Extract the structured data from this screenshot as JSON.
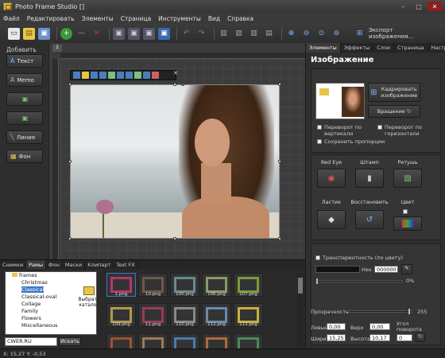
{
  "window": {
    "title": "Photo Frame Studio []"
  },
  "menu": [
    "Файл",
    "Редактировать",
    "Элементы",
    "Страница",
    "Инструменты",
    "Вид",
    "Справка"
  ],
  "toolbar": {
    "export_label": "Экспорт изображения..."
  },
  "left_panel": {
    "add_label": "Добавить",
    "buttons": [
      "Текст",
      "Memo",
      "",
      "",
      "Линия",
      "Фон"
    ]
  },
  "canvas": {
    "tab": "1"
  },
  "right_panel": {
    "tabs": [
      "Элементы",
      "Эффекты",
      "Слои",
      "Страница",
      "Настр"
    ],
    "title": "Изображение",
    "crop_label": "Кадрировать изображение",
    "rotate_label": "Вращение",
    "flip_v": "Переворот по вертикали",
    "flip_h": "Переворот по горизонтали",
    "keep_ratio": "Сохранить пропорции",
    "tools": [
      "Red Eye",
      "Штамп",
      "Ретушь",
      "Ластик",
      "Восстановить",
      "Цвет"
    ],
    "transparency_label": "Транспарентность (по цвету)",
    "hex_label": "Hex",
    "hex_value": "000000",
    "percent_label": "0%",
    "opacity_label": "Прозрачность",
    "opacity_value": "255",
    "left_label": "Левый",
    "left_value": "0,00",
    "top_label": "Верх",
    "top_value": "0,00",
    "angle_label": "Угол поворота",
    "angle_value": "0",
    "width_label": "Ширина",
    "width_value": "15,25",
    "height_label": "Высота",
    "height_value": "10,17"
  },
  "bottom_panel": {
    "tabs": [
      "Снимки",
      "Рамы",
      "Фон",
      "Маски",
      "Клипарт",
      "Text FX"
    ],
    "active_tab": "Рамы",
    "tree_root": "frames",
    "tree_items": [
      "Christmas",
      "Classical",
      "Classical-oval",
      "Collage",
      "Family",
      "Flowers",
      "Miscellaneous"
    ],
    "selected_item": "Classical",
    "choose_catalog": "Выбрать каталог",
    "search_value": "CWER.RU",
    "search_button": "Искать",
    "frames": [
      "1.png",
      "10.png",
      "100.png",
      "106.png",
      "107.png",
      "109.png",
      "11.png",
      "110.png",
      "112.png",
      "113.png"
    ]
  },
  "status": {
    "coords": "X: 15,27 Y: -0,53"
  },
  "colors": {
    "accent": "#3a78c8",
    "panel": "#2f2f2f",
    "bg": "#2b2b2b"
  }
}
